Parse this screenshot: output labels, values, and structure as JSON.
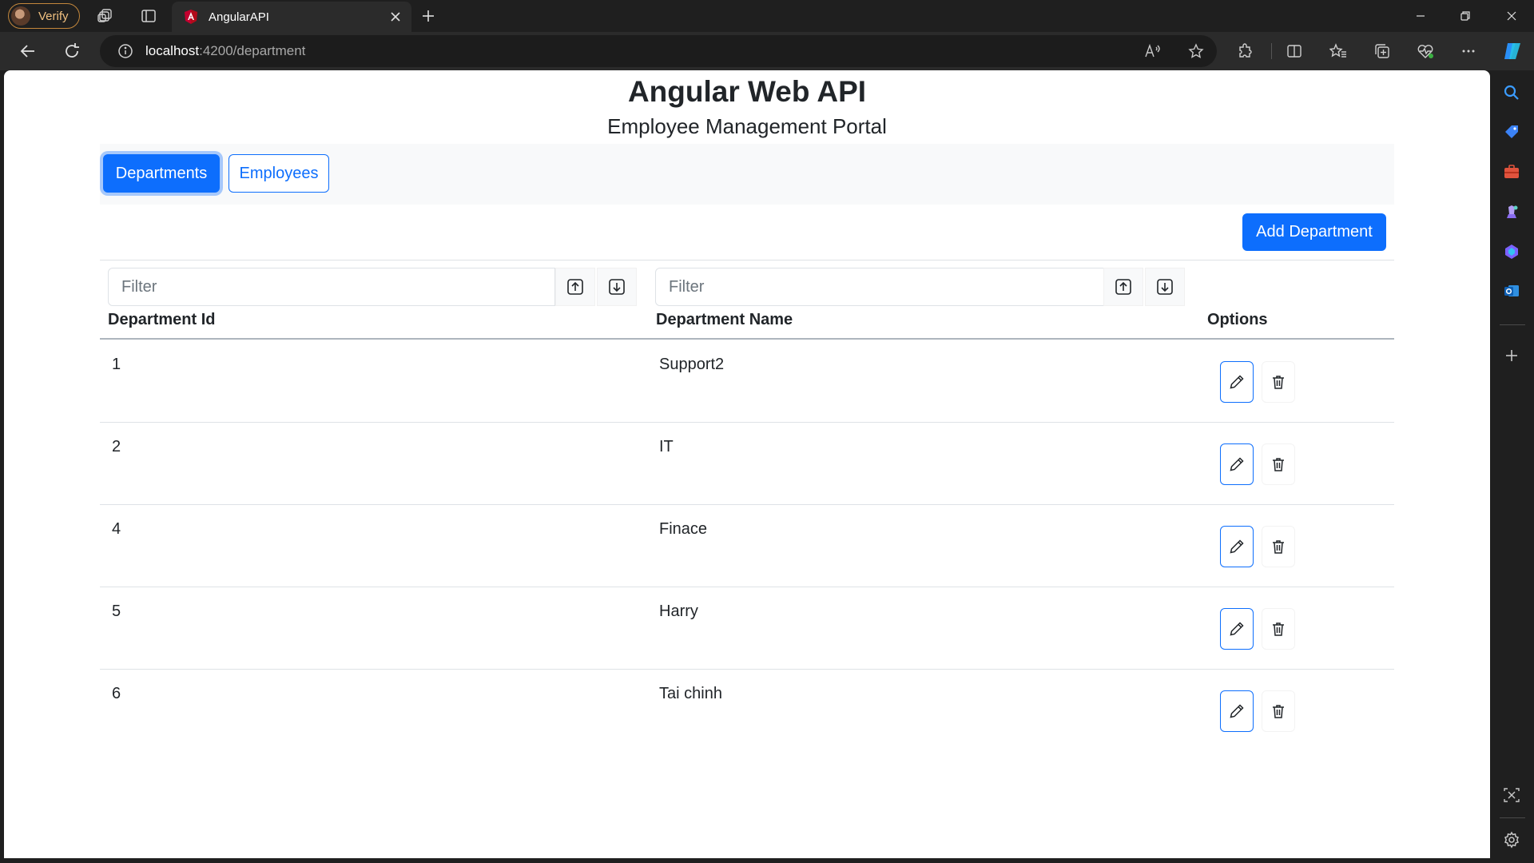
{
  "browser": {
    "profile_label": "Verify",
    "tab_title": "AngularAPI",
    "url_host": "localhost",
    "url_path": ":4200/department"
  },
  "page": {
    "title": "Angular Web API",
    "subtitle": "Employee Management Portal"
  },
  "nav": {
    "departments_label": "Departments",
    "employees_label": "Employees"
  },
  "toolbar": {
    "add_label": "Add Department"
  },
  "filters": {
    "id_placeholder": "Filter",
    "name_placeholder": "Filter"
  },
  "table": {
    "headers": [
      "Department Id",
      "Department Name",
      "Options"
    ],
    "rows": [
      {
        "id": "1",
        "name": "Support2"
      },
      {
        "id": "2",
        "name": "IT"
      },
      {
        "id": "4",
        "name": "Finace"
      },
      {
        "id": "5",
        "name": "Harry"
      },
      {
        "id": "6",
        "name": "Tai chinh"
      }
    ]
  },
  "colors": {
    "primary": "#0d6efd",
    "nav_band": "#f8f9fa",
    "chrome_bg": "#1f1f1f"
  }
}
